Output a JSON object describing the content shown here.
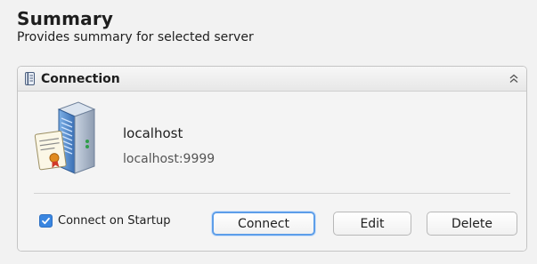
{
  "header": {
    "title": "Summary",
    "subtitle": "Provides summary for selected server"
  },
  "connection_panel": {
    "title": "Connection",
    "header_icon": "document-icon",
    "collapse_icon": "double-chevron-up-icon",
    "server_icon": "server-certificate-icon",
    "server_name": "localhost",
    "server_address": "localhost:9999",
    "connect_on_startup": {
      "label": "Connect on Startup",
      "checked": true
    },
    "buttons": {
      "connect": "Connect",
      "edit": "Edit",
      "delete": "Delete"
    }
  },
  "colors": {
    "accent": "#3a86e0",
    "focus_ring": "#5d9ee9"
  }
}
